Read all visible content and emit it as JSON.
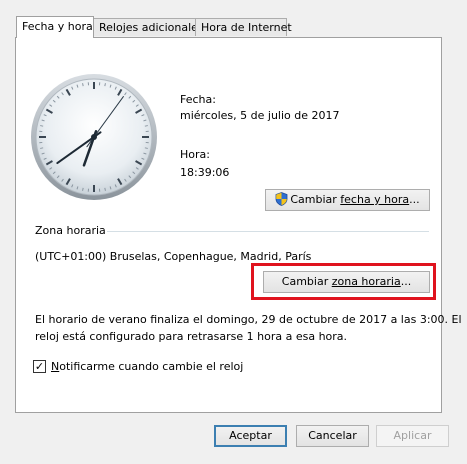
{
  "tabs": [
    {
      "label": "Fecha y hora",
      "active": true
    },
    {
      "label": "Relojes adicionales",
      "active": false
    },
    {
      "label": "Hora de Internet",
      "active": false
    }
  ],
  "clock": {
    "hour": 18,
    "minute": 39,
    "second": 6
  },
  "date_label": "Fecha:",
  "date_value": "miércoles, 5 de julio de 2017",
  "time_label": "Hora:",
  "time_value": "18:39:06",
  "change_datetime_button": {
    "prefix": "Cambiar ",
    "accel": "fecha y hora",
    "suffix": "...",
    "icon": "shield-icon"
  },
  "timezone_group_label": "Zona horaria",
  "timezone_value": "(UTC+01:00) Bruselas, Copenhague, Madrid, París",
  "change_timezone_button": {
    "prefix": "Cambiar ",
    "accel": "zona horaria",
    "suffix": "..."
  },
  "dst_notice_line1": "El horario de verano finaliza el domingo, 29 de octubre de 2017 a las 3:00. El",
  "dst_notice_line2": "reloj está configurado para retrasarse 1 hora a esa hora.",
  "notify_checkbox": {
    "checked": true,
    "accel": "N",
    "rest": "otificarme cuando cambie el reloj"
  },
  "footer": {
    "accept": "Aceptar",
    "cancel": "Cancelar",
    "apply": "Aplicar"
  },
  "colors": {
    "highlight": "#e0131e",
    "accent": "#3c7fb1"
  }
}
